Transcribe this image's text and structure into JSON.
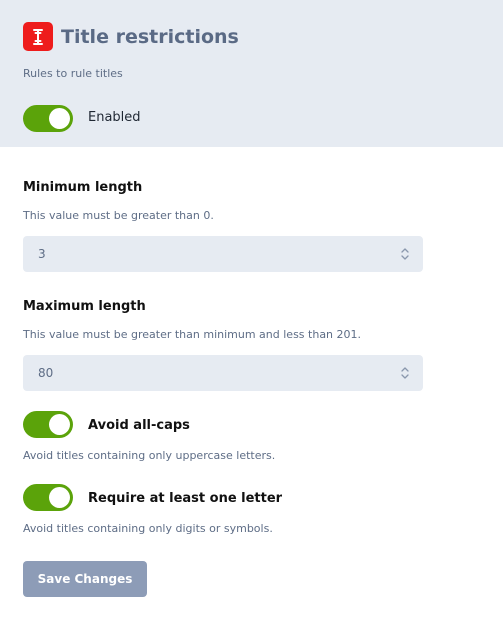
{
  "header": {
    "icon": "text-cursor-icon",
    "title": "Title restrictions",
    "subtitle": "Rules to rule titles",
    "enabled_label": "Enabled",
    "enabled": true
  },
  "fields": {
    "min": {
      "label": "Minimum length",
      "help": "This value must be greater than 0.",
      "value": "3"
    },
    "max": {
      "label": "Maximum length",
      "help": "This value must be greater than minimum and less than 201.",
      "value": "80"
    }
  },
  "options": {
    "avoid_caps": {
      "label": "Avoid all-caps",
      "help": "Avoid titles containing only uppercase letters.",
      "enabled": true
    },
    "require_letter": {
      "label": "Require at least one letter",
      "help": "Avoid titles containing only digits or symbols.",
      "enabled": true
    }
  },
  "save_label": "Save Changes",
  "colors": {
    "accent_green": "#5ba30a",
    "icon_red": "#ee1c1c",
    "header_bg": "#e6ebf2",
    "button_bg": "#8d9cb7"
  }
}
